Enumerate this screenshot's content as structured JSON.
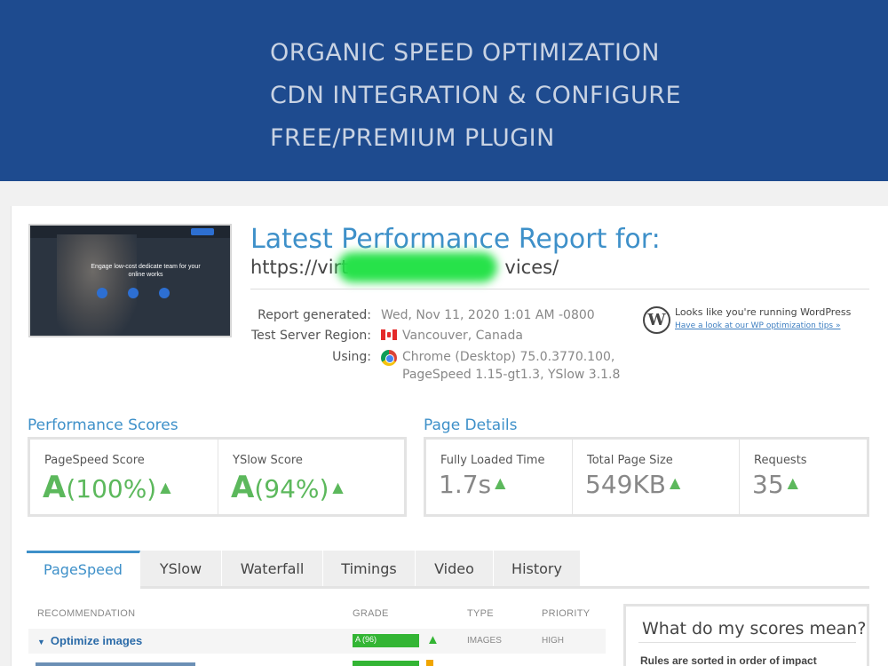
{
  "banner": {
    "lines": [
      "ORGANIC SPEED OPTIMIZATION",
      "CDN INTEGRATION & CONFIGURE",
      "FREE/PREMIUM PLUGIN"
    ]
  },
  "thumbnail": {
    "headline": "Engage low-cost dedicate team for your online works"
  },
  "report": {
    "title": "Latest Performance Report for:",
    "url_start": "https://virt",
    "url_end": "vices/",
    "generated_label": "Report generated:",
    "generated_value": "Wed, Nov 11, 2020 1:01 AM -0800",
    "region_label": "Test Server Region:",
    "region_value": "Vancouver, Canada",
    "using_label": "Using:",
    "using_value_1": "Chrome (Desktop) 75.0.3770.100,",
    "using_value_2": "PageSpeed 1.15-gt1.3, YSlow 3.1.8"
  },
  "wordpress": {
    "line1": "Looks like you're running WordPress",
    "link": "Have a look at our WP optimization tips »"
  },
  "performance": {
    "heading": "Performance Scores",
    "pagespeed_label": "PageSpeed Score",
    "pagespeed_grade": "A",
    "pagespeed_pct": "(100%)",
    "yslow_label": "YSlow Score",
    "yslow_grade": "A",
    "yslow_pct": "(94%)"
  },
  "details": {
    "heading": "Page Details",
    "load_label": "Fully Loaded Time",
    "load_value": "1.7s",
    "size_label": "Total Page Size",
    "size_value": "549KB",
    "requests_label": "Requests",
    "requests_value": "35"
  },
  "tabs": [
    "PageSpeed",
    "YSlow",
    "Waterfall",
    "Timings",
    "Video",
    "History"
  ],
  "active_tab": "PageSpeed",
  "table": {
    "headers": [
      "RECOMMENDATION",
      "GRADE",
      "TYPE",
      "PRIORITY"
    ],
    "rows": [
      {
        "title": "Optimize images",
        "grade": "A (96)",
        "grade_percent": 96,
        "type": "IMAGES",
        "priority": "HIGH"
      }
    ]
  },
  "sidebar": {
    "title": "What do my scores mean?",
    "subtitle": "Rules are sorted in order of impact"
  },
  "colors": {
    "banner": "#1e4b8f",
    "accent": "#3e90c9",
    "grade_green": "#5cb85c",
    "bar_green": "#33b534"
  },
  "icons": [
    "chevron-up-icon",
    "canada-flag-icon",
    "chrome-icon",
    "wordpress-logo-icon",
    "caret-down-icon"
  ]
}
